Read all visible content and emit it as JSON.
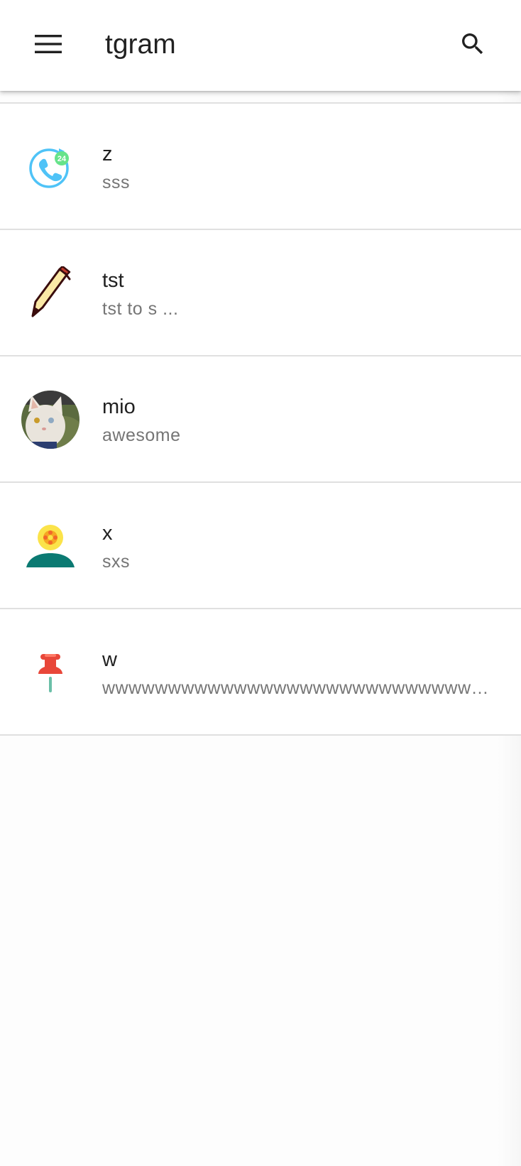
{
  "app": {
    "title": "tgram"
  },
  "icons": {
    "menu": "menu-icon",
    "search": "search-icon"
  },
  "colors": {
    "text_primary": "#212121",
    "text_secondary": "#757575",
    "divider": "#e0e0e0"
  },
  "chats": [
    {
      "name": "z",
      "message": "sss",
      "avatar_icon": "phone-24h-icon"
    },
    {
      "name": "tst",
      "message": "tst to s ...",
      "avatar_icon": "pencil-icon"
    },
    {
      "name": "mio",
      "message": "awesome",
      "avatar_icon": "cat-photo-avatar"
    },
    {
      "name": "x",
      "message": "sxs",
      "avatar_icon": "flower-island-icon"
    },
    {
      "name": "w",
      "message": "wwwwwwwwwwwwwwwwwwwwwwwwwwwwwwwwwwww",
      "avatar_icon": "pushpin-icon"
    }
  ]
}
